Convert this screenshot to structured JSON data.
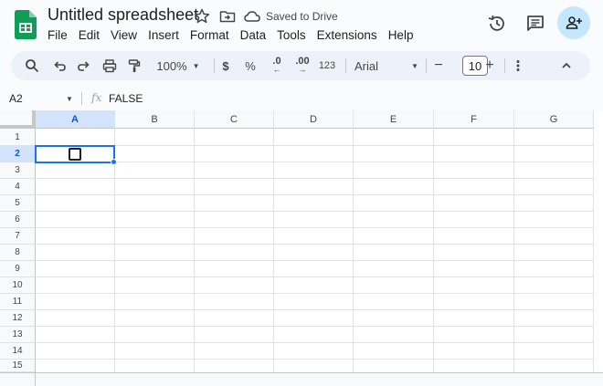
{
  "header": {
    "title": "Untitled spreadsheet",
    "saved_status": "Saved to Drive",
    "menu": [
      "File",
      "Edit",
      "View",
      "Insert",
      "Format",
      "Data",
      "Tools",
      "Extensions",
      "Help"
    ]
  },
  "toolbar": {
    "zoom": "100%",
    "currency": "$",
    "percent": "%",
    "dec_decrease": ".0",
    "dec_increase": ".00",
    "number_format": "123",
    "font": "Arial",
    "font_size": "10",
    "minus": "−",
    "plus": "+"
  },
  "formula_bar": {
    "cell_ref": "A2",
    "fx": "fx",
    "value": "FALSE"
  },
  "grid": {
    "columns": [
      "A",
      "B",
      "C",
      "D",
      "E",
      "F",
      "G"
    ],
    "rows": [
      "1",
      "2",
      "3",
      "4",
      "5",
      "6",
      "7",
      "8",
      "9",
      "10",
      "11",
      "12",
      "13",
      "14",
      "15"
    ],
    "selected_column": "A",
    "selected_row": "2",
    "A2_checkbox_checked": false
  },
  "colors": {
    "accent": "#1a73e8",
    "selection_header": "#d3e3fd",
    "share_button": "#c2e7ff",
    "sheets_green": "#0f9d58"
  }
}
